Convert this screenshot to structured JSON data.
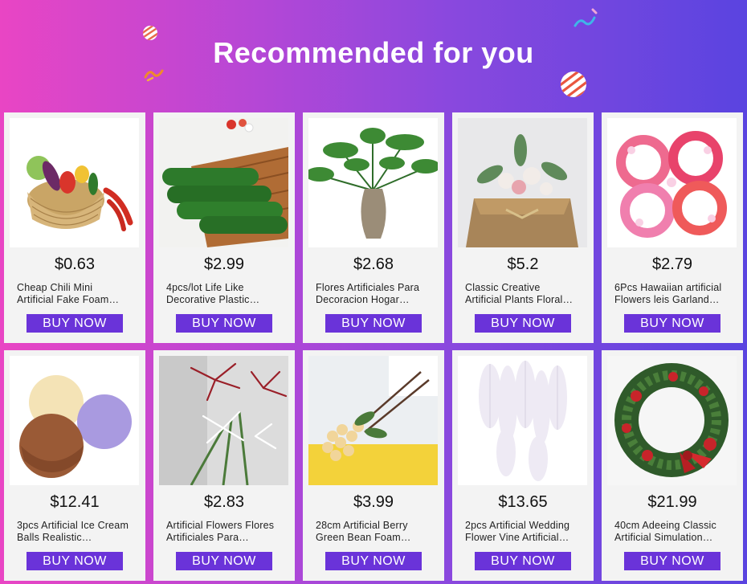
{
  "header": {
    "title": "Recommended for you"
  },
  "products": [
    {
      "price": "$0.63",
      "title_line1": "Cheap Chili Mini",
      "title_line2": "Artificial Fake Foam…",
      "button": "BUY NOW",
      "image": "vegetable-basket-image"
    },
    {
      "price": "$2.99",
      "title_line1": "4pcs/lot Life Like",
      "title_line2": "Decorative Plastic…",
      "button": "BUY NOW",
      "image": "cucumber-image"
    },
    {
      "price": "$2.68",
      "title_line1": "Flores Artificiales Para",
      "title_line2": "Decoracion Hogar…",
      "button": "BUY NOW",
      "image": "pine-plant-vase-image"
    },
    {
      "price": "$5.2",
      "title_line1": "Classic Creative",
      "title_line2": "Artificial Plants Floral…",
      "button": "BUY NOW",
      "image": "burlap-floral-pot-image"
    },
    {
      "price": "$2.79",
      "title_line1": "6Pcs Hawaiian artificial",
      "title_line2": "Flowers leis Garland…",
      "button": "BUY NOW",
      "image": "hawaiian-leis-image"
    },
    {
      "price": "$12.41",
      "title_line1": "3pcs Artificial Ice Cream",
      "title_line2": "Balls Realistic…",
      "button": "BUY NOW",
      "image": "ice-cream-balls-image"
    },
    {
      "price": "$2.83",
      "title_line1": "Artificial Flowers Flores",
      "title_line2": "Artificiales Para…",
      "button": "BUY NOW",
      "image": "spider-flowers-image"
    },
    {
      "price": "$3.99",
      "title_line1": "28cm Artificial Berry",
      "title_line2": "Green Bean Foam…",
      "button": "BUY NOW",
      "image": "berry-branch-image"
    },
    {
      "price": "$13.65",
      "title_line1": "2pcs Artificial Wedding",
      "title_line2": "Flower Vine Artificial…",
      "button": "BUY NOW",
      "image": "wisteria-vine-image"
    },
    {
      "price": "$21.99",
      "title_line1": "40cm Adeeing Classic",
      "title_line2": "Artificial Simulation…",
      "button": "BUY NOW",
      "image": "christmas-wreath-image"
    }
  ],
  "colors": {
    "button_bg": "#6a33d9",
    "card_bg": "#f3f3f3",
    "gradient_left": "#e945c4",
    "gradient_right": "#5a44e0"
  }
}
